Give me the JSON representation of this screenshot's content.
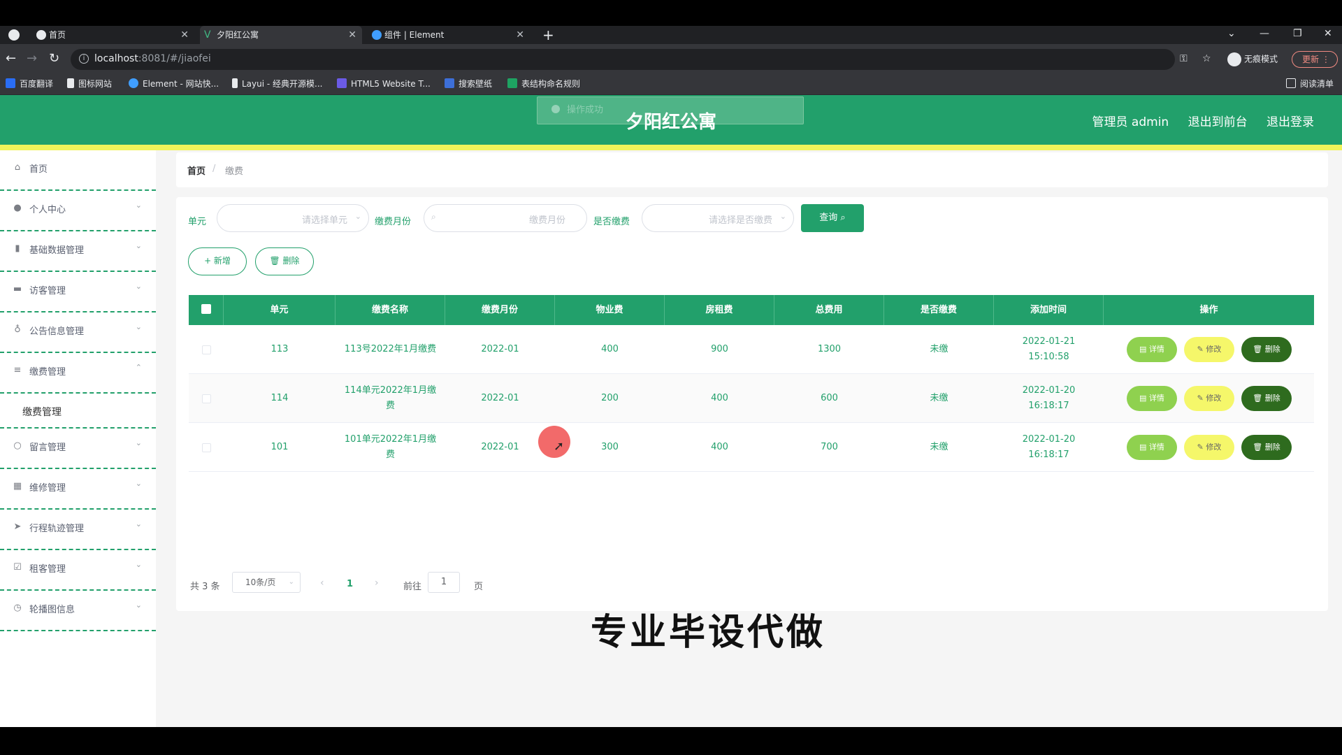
{
  "browser": {
    "tabs": [
      {
        "title": "首页"
      },
      {
        "title": "夕阳红公寓"
      },
      {
        "title": "组件 | Element"
      }
    ],
    "url_host": "localhost",
    "url_rest": ":8081/#/jiaofei",
    "profile": "无痕模式",
    "update_label": "更新",
    "bookmarks": [
      "百度翻译",
      "图标网站",
      "Element - 网站快...",
      "Layui - 经典开源模...",
      "HTML5 Website T...",
      "搜索壁纸",
      "表结构命名规则"
    ],
    "reading_list": "阅读清单"
  },
  "header": {
    "title": "夕阳红公寓",
    "admin": "管理员 admin",
    "to_front": "退出到前台",
    "logout": "退出登录",
    "toast": "操作成功"
  },
  "sidebar": {
    "items": [
      {
        "label": "首页",
        "icon": "home-icon"
      },
      {
        "label": "个人中心",
        "icon": "user-icon"
      },
      {
        "label": "基础数据管理",
        "icon": "chart-icon"
      },
      {
        "label": "访客管理",
        "icon": "monitor-icon"
      },
      {
        "label": "公告信息管理",
        "icon": "mic-icon"
      },
      {
        "label": "缴费管理",
        "icon": "sliders-icon"
      },
      {
        "label": "留言管理",
        "icon": "circle-icon"
      },
      {
        "label": "维修管理",
        "icon": "grid-icon"
      },
      {
        "label": "行程轨迹管理",
        "icon": "send-icon"
      },
      {
        "label": "租客管理",
        "icon": "checkbox-icon"
      },
      {
        "label": "轮播图信息",
        "icon": "clock-icon"
      }
    ],
    "sub_item": "缴费管理"
  },
  "breadcrumb": {
    "home": "首页",
    "sep": "/",
    "current": "缴费"
  },
  "filters": {
    "unit_label": "单元",
    "unit_placeholder": "请选择单元",
    "month_label": "缴费月份",
    "month_placeholder": "缴费月份",
    "paid_label": "是否缴费",
    "paid_placeholder": "请选择是否缴费",
    "query_label": "查询 ⌕"
  },
  "actions": {
    "add": "+ 新增",
    "delete": "🗑 删除"
  },
  "table": {
    "headers": [
      "单元",
      "缴费名称",
      "缴费月份",
      "物业费",
      "房租费",
      "总费用",
      "是否缴费",
      "添加时间",
      "操作"
    ],
    "rows": [
      {
        "unit": "113",
        "name": "113号2022年1月缴费",
        "month": "2022-01",
        "property": "400",
        "rent": "900",
        "total": "1300",
        "paid": "未缴",
        "time": "2022-01-21 15:10:58"
      },
      {
        "unit": "114",
        "name": "114单元2022年1月缴费",
        "month": "2022-01",
        "property": "200",
        "rent": "400",
        "total": "600",
        "paid": "未缴",
        "time": "2022-01-20 16:18:17"
      },
      {
        "unit": "101",
        "name": "101单元2022年1月缴费",
        "month": "2022-01",
        "property": "300",
        "rent": "400",
        "total": "700",
        "paid": "未缴",
        "time": "2022-01-20 16:18:17"
      }
    ],
    "btn_detail": "详情",
    "btn_edit": "修改",
    "btn_delete": "删除"
  },
  "pager": {
    "total": "共 3 条",
    "size": "10条/页",
    "current": "1",
    "goto": "前往",
    "goto_value": "1",
    "page": "页"
  },
  "overlay_caption": "专业毕设代做",
  "colors": {
    "primary": "#22a06b",
    "header_bar": "#f0f35a",
    "detail": "#8fd14f",
    "edit": "#f5f76a",
    "delete": "#2e6b1e"
  }
}
